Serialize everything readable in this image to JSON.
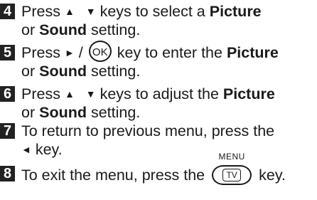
{
  "steps": [
    {
      "number": "4",
      "line1": {
        "t1": "Press",
        "t2": "keys to select a",
        "b1": "Picture"
      },
      "line2": {
        "t1": "or",
        "b1": "Sound",
        "t2": "setting."
      },
      "arrows": "▲ ▼"
    },
    {
      "number": "5",
      "line1": {
        "t1": "Press",
        "sep": "/",
        "ok": "OK",
        "t2": "key to enter the",
        "b1": "Picture"
      },
      "line2": {
        "t1": "or",
        "b1": "Sound",
        "t2": "setting."
      },
      "arrow_right": "►"
    },
    {
      "number": "6",
      "line1": {
        "t1": "Press",
        "t2": "keys to adjust the",
        "b1": "Picture"
      },
      "line2": {
        "t1": "or",
        "b1": "Sound",
        "t2": "setting."
      },
      "arrows": "▲ ▼"
    },
    {
      "number": "7",
      "line1": {
        "t1": "To return to previous menu, press the"
      },
      "line2": {
        "t2": "key."
      },
      "arrow_left": "◄"
    },
    {
      "number": "8",
      "line1": {
        "t1": "To exit the menu, press the",
        "menu": "MENU",
        "tv": "TV",
        "t2": "key."
      }
    }
  ]
}
